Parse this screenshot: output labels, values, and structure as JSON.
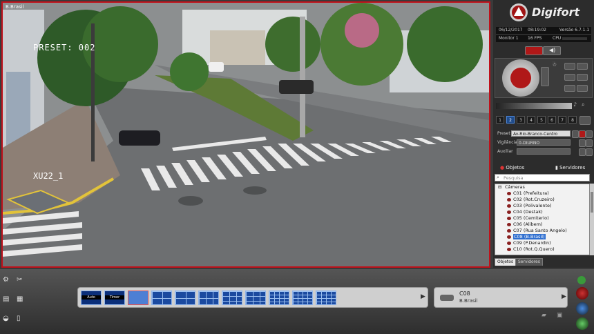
{
  "video": {
    "title": "B.Brasil",
    "osd_preset": "PRESET: 002",
    "osd_code": "XU22_1"
  },
  "brand": {
    "name": "Digifort"
  },
  "status": {
    "date": "06/12/2017",
    "time": "08:19:02",
    "version": "Versão 6.7.1.1",
    "monitor": "Monitor 1",
    "fps": "16 FPS",
    "cpu_label": "CPU"
  },
  "ptz_numbers": [
    "1",
    "2",
    "3",
    "4",
    "5",
    "6",
    "7",
    "8"
  ],
  "preset": {
    "label": "Preset",
    "value": "Av-Rio-Branco-Centro"
  },
  "vigilancia": {
    "label": "Vigilância",
    "value": "0-DIURNO"
  },
  "auxiliar": {
    "label": "Auxiliar",
    "value": ""
  },
  "objects_panel": {
    "tab_objetos": "Objetos",
    "tab_servidores": "Servidores",
    "search_placeholder": "Pesquisa",
    "root": "Câmeras",
    "cameras": [
      "C01 (Prefeitura)",
      "C02 (Rot.Cruzeiro)",
      "C03 (Polivalente)",
      "C04 (Destak)",
      "C05 (Cemiterio)",
      "C06 (Alibem)",
      "C07 (Rua Santo Angelo)",
      "C08 (B.Brasil)",
      "C09 (P.Denardin)",
      "C10 (Rot.Q.Quero)"
    ],
    "selected_index": 7
  },
  "bottom_tabs": {
    "objetos": "Objetos",
    "servidores": "Servidores"
  },
  "layouts": {
    "auto": "Auto",
    "timer": "Timer"
  },
  "active_camera": {
    "code": "C08",
    "name": "B.Brasil"
  },
  "colors": {
    "accent_red": "#c0101a",
    "selection_blue": "#2f6fd0"
  }
}
